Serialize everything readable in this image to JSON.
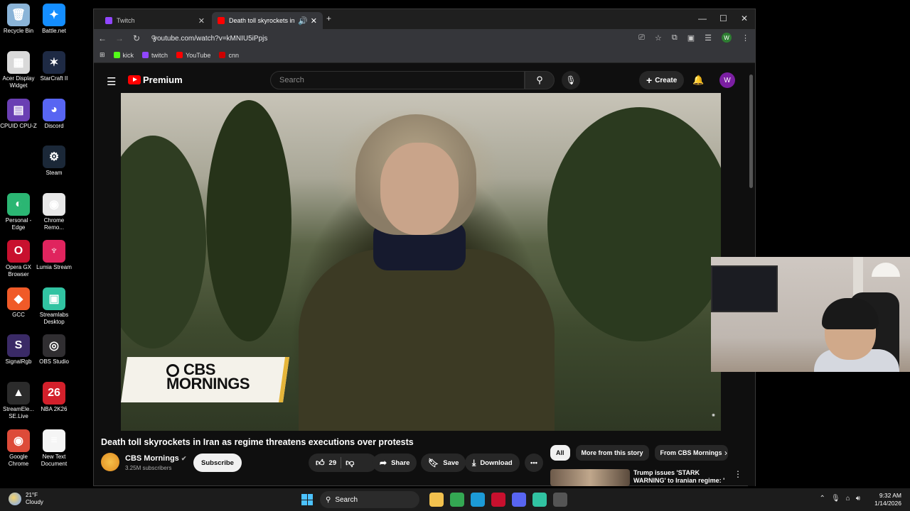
{
  "desktop_icons": [
    {
      "label": "Recycle Bin",
      "color": "#8ab4d8",
      "glyph": "🗑"
    },
    {
      "label": "Battle.net",
      "color": "#148eff",
      "glyph": "✦"
    },
    {
      "label": "Acer Display Widget",
      "color": "#d9d9d9",
      "glyph": "▦"
    },
    {
      "label": "StarCraft II",
      "color": "#1e2a44",
      "glyph": "✶"
    },
    {
      "label": "CPUID CPU-Z",
      "color": "#6a3fb3",
      "glyph": "▤"
    },
    {
      "label": "Discord",
      "color": "#5865f2",
      "glyph": "◕"
    },
    {
      "label": "Steam",
      "color": "#1b2838",
      "glyph": "⚙"
    },
    {
      "label": "Personal - Edge",
      "color": "#2bb673",
      "glyph": "◐"
    },
    {
      "label": "Chrome Remo...",
      "color": "#e8e8e8",
      "glyph": "◉"
    },
    {
      "label": "Opera GX Browser",
      "color": "#c8102e",
      "glyph": "O"
    },
    {
      "label": "Lumia Stream",
      "color": "#e0245e",
      "glyph": "♆"
    },
    {
      "label": "GCC",
      "color": "#f05a28",
      "glyph": "◆"
    },
    {
      "label": "Streamlabs Desktop",
      "color": "#31c3a2",
      "glyph": "▣"
    },
    {
      "label": "SignalRgb",
      "color": "#3a2a66",
      "glyph": "S"
    },
    {
      "label": "OBS Studio",
      "color": "#302e31",
      "glyph": "◎"
    },
    {
      "label": "StreamEle... SE.Live",
      "color": "#2b2b2b",
      "glyph": "▲"
    },
    {
      "label": "NBA 2K26",
      "color": "#d3202b",
      "glyph": "26"
    },
    {
      "label": "Google Chrome",
      "color": "#dd4b39",
      "glyph": "◉"
    },
    {
      "label": "New Text Document",
      "color": "#f5f5f5",
      "glyph": "≡"
    }
  ],
  "browser": {
    "tabs": [
      {
        "title": "Twitch",
        "favicon_color": "#9146ff",
        "active": false
      },
      {
        "title": "Death toll skyrockets in Iran",
        "favicon_color": "#ff0000",
        "active": true
      }
    ],
    "new_tab": "+",
    "url": "youtube.com/watch?v=kMNIU5iPpjs",
    "bookmarks": [
      {
        "label": "kick",
        "color": "#53fc18"
      },
      {
        "label": "twitch",
        "color": "#9146ff"
      },
      {
        "label": "YouTube",
        "color": "#ff0000"
      },
      {
        "label": "cnn",
        "color": "#cc0000"
      }
    ],
    "profile_initial": "W"
  },
  "youtube": {
    "logo_text": "Premium",
    "search_placeholder": "Search",
    "create_label": "Create",
    "avatar_initial": "W",
    "video": {
      "overlay_brand_line1": "CBS",
      "overlay_brand_line2": "MORNINGS",
      "title": "Death toll skyrockets in Iran as regime threatens executions over protests"
    },
    "channel": {
      "name": "CBS Mornings",
      "subscribers": "3.25M subscribers",
      "subscribe_label": "Subscribe"
    },
    "actions": {
      "like_count": "29",
      "share_label": "Share",
      "save_label": "Save",
      "download_label": "Download"
    },
    "chips": [
      "All",
      "More from this story",
      "From CBS Mornings"
    ],
    "recommendation": {
      "title": "Trump issues 'STARK WARNING' to Iranian regime: '"
    }
  },
  "taskbar": {
    "temperature": "21°F",
    "condition": "Cloudy",
    "search_label": "Search",
    "time": "9:32 AM",
    "date": "1/14/2026",
    "apps": [
      {
        "name": "file-explorer",
        "color": "#f2c14e"
      },
      {
        "name": "chrome",
        "color": "#34a853"
      },
      {
        "name": "edge",
        "color": "#1c9bd7"
      },
      {
        "name": "opera-gx",
        "color": "#c8102e"
      },
      {
        "name": "discord",
        "color": "#5865f2"
      },
      {
        "name": "streamlabs",
        "color": "#31c3a2"
      },
      {
        "name": "obs",
        "color": "#555555"
      }
    ]
  }
}
